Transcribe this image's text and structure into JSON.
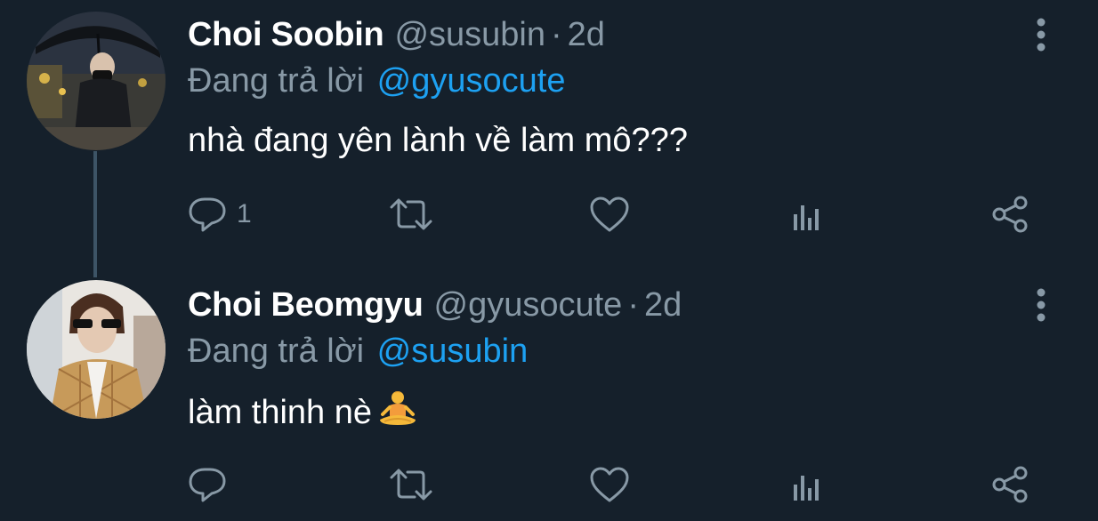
{
  "tweets": [
    {
      "display_name": "Choi Soobin",
      "handle": "@susubin",
      "separator": "·",
      "time": "2d",
      "reply_prefix": "Đang trả lời",
      "reply_to": "@gyusocute",
      "text": "nhà đang yên lành về làm mô???",
      "emoji": "",
      "reply_count": "1"
    },
    {
      "display_name": "Choi Beomgyu",
      "handle": "@gyusocute",
      "separator": "·",
      "time": "2d",
      "reply_prefix": "Đang trả lời",
      "reply_to": "@susubin",
      "text": "làm thinh nè",
      "emoji": "person-in-lotus-position",
      "reply_count": ""
    }
  ],
  "icons": {
    "reply": "reply-icon",
    "retweet": "retweet-icon",
    "like": "like-icon",
    "stats": "stats-icon",
    "share": "share-icon",
    "more": "more-options-icon"
  },
  "colors": {
    "background": "#15202b",
    "primary_text": "#ffffff",
    "secondary_text": "#8899a6",
    "accent": "#1da1f2",
    "thread_line": "#3d5466"
  }
}
